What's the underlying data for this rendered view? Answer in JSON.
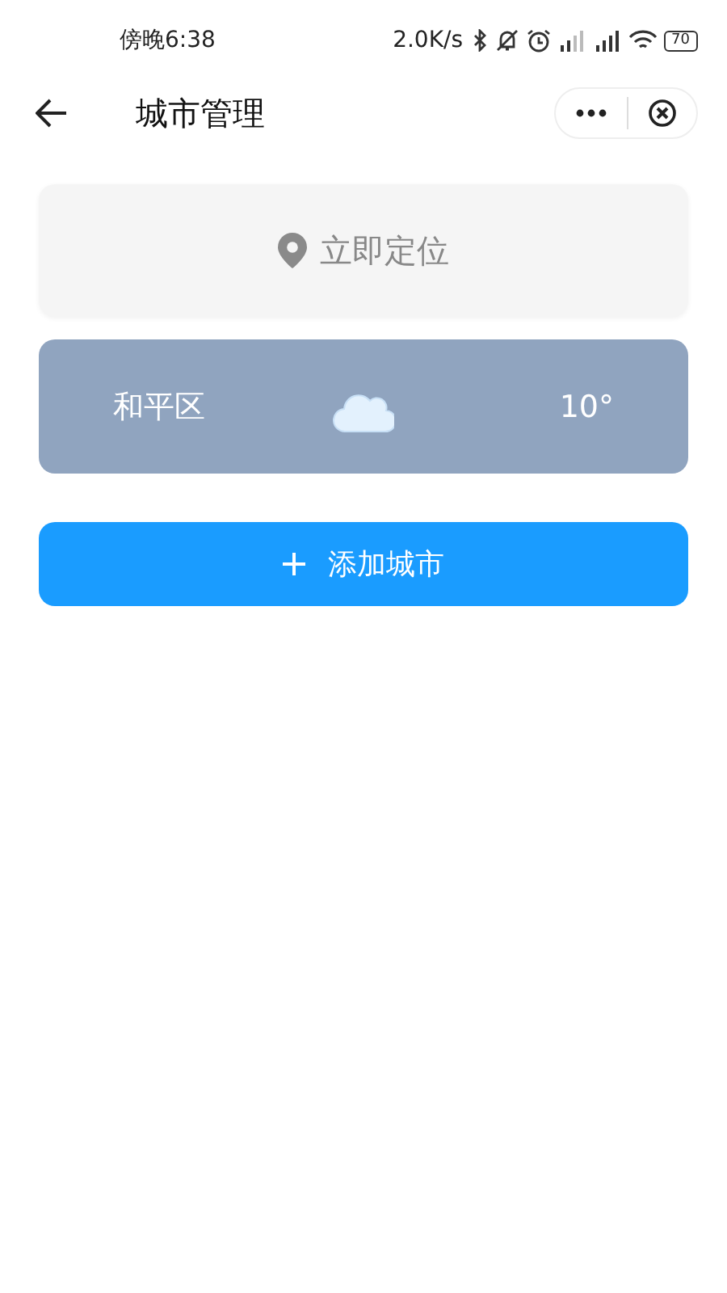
{
  "status_bar": {
    "time": "傍晚6:38",
    "network_speed": "2.0K/s",
    "battery": "70"
  },
  "header": {
    "title": "城市管理"
  },
  "locate": {
    "label": "立即定位"
  },
  "cities": [
    {
      "name": "和平区",
      "temperature": "10°",
      "kind": "cloudy"
    }
  ],
  "add_button": {
    "label": "添加城市"
  }
}
